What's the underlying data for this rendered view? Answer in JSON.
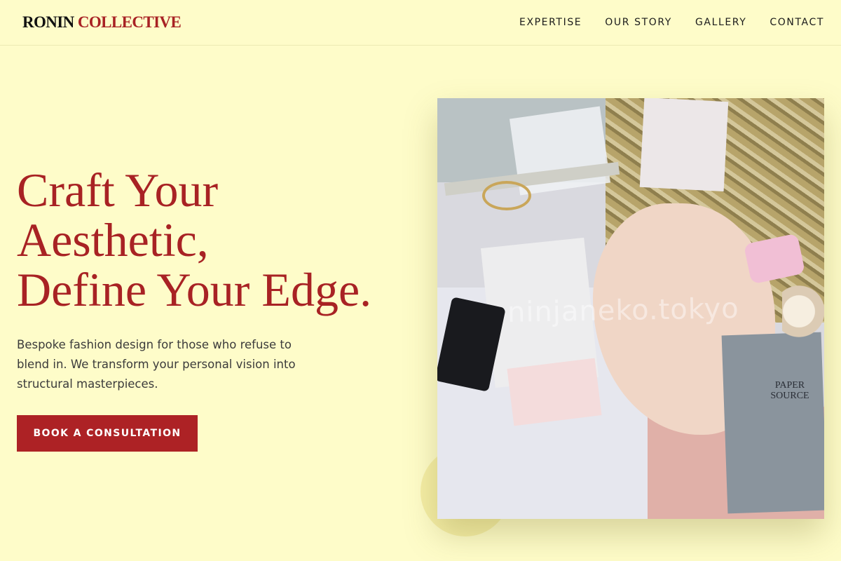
{
  "header": {
    "logo_primary": "RONIN",
    "logo_accent": "COLLECTIVE",
    "nav": [
      {
        "label": "EXPERTISE"
      },
      {
        "label": "OUR STORY"
      },
      {
        "label": "GALLERY"
      },
      {
        "label": "CONTACT"
      }
    ]
  },
  "hero": {
    "title_lines": [
      "Craft Your",
      "Aesthetic,",
      "Define Your Edge."
    ],
    "subtitle": "Bespoke fashion design for those who refuse to blend in. We transform your personal vision into structural masterpieces.",
    "cta_label": "BOOK A CONSULTATION",
    "image": {
      "watermark": "ninjaneko.tokyo",
      "brand_stamp": "PAPER SOURCE"
    }
  },
  "colors": {
    "background": "#fefcc9",
    "accent": "#a82224",
    "button": "#ad2225"
  }
}
